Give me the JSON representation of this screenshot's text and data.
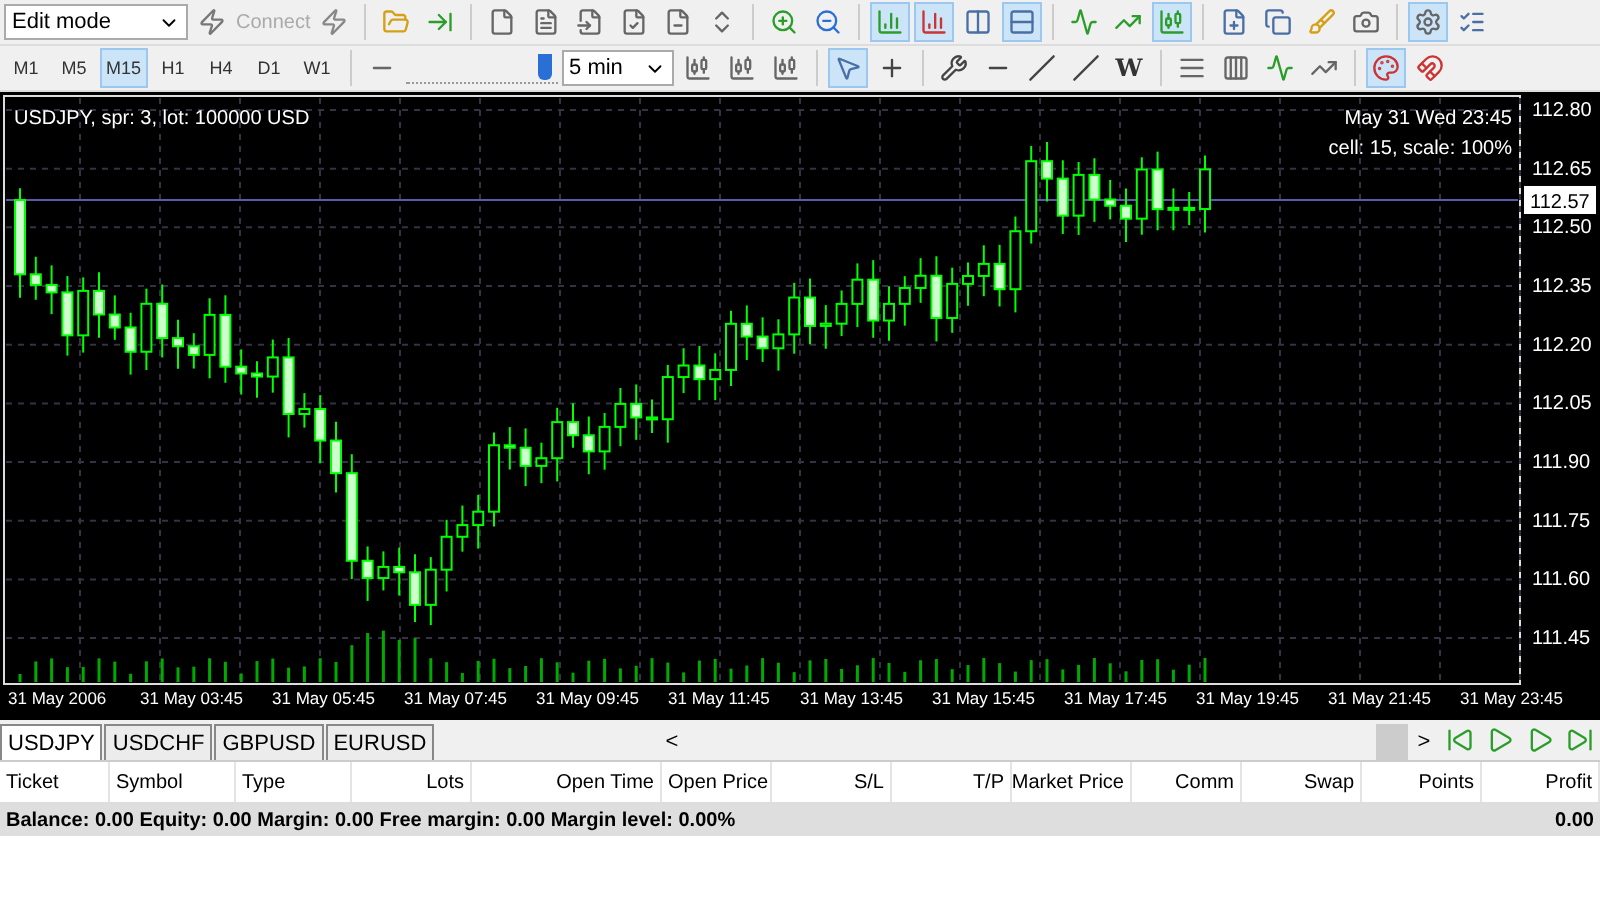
{
  "toolbar": {
    "mode": "Edit mode",
    "connect_label": "Connect",
    "timeframes": [
      {
        "label": "M1",
        "selected": false
      },
      {
        "label": "M5",
        "selected": false
      },
      {
        "label": "M15",
        "selected": true
      },
      {
        "label": "H1",
        "selected": false
      },
      {
        "label": "H4",
        "selected": false
      },
      {
        "label": "D1",
        "selected": false
      },
      {
        "label": "W1",
        "selected": false
      }
    ],
    "speed": {
      "level": 0.93
    },
    "interval": "5 min",
    "text_tool": "W"
  },
  "chart": {
    "title": "USDJPY, spr: 3, lot: 100000 USD",
    "datetime": "May 31 Wed 23:45",
    "scale_info": "cell: 15, scale: 100%",
    "price_labels": [
      "112.80",
      "112.65",
      "112.50",
      "112.35",
      "112.20",
      "112.05",
      "111.90",
      "111.75",
      "111.60",
      "111.45"
    ],
    "current_price": "112.57",
    "time_labels": [
      "31 May 2006",
      "31 May 03:45",
      "31 May 05:45",
      "31 May 07:45",
      "31 May 09:45",
      "31 May 11:45",
      "31 May 13:45",
      "31 May 15:45",
      "31 May 17:45",
      "31 May 19:45",
      "31 May 21:45",
      "31 May 23:45"
    ]
  },
  "symbol_tabs": [
    {
      "label": "USDJPY",
      "selected": true
    },
    {
      "label": "USDCHF",
      "selected": false
    },
    {
      "label": "GBPUSD",
      "selected": false
    },
    {
      "label": "EURUSD",
      "selected": false
    }
  ],
  "scroll_left": "<",
  "scroll_right": ">",
  "table": {
    "columns": [
      "Ticket",
      "Symbol",
      "Type",
      "Lots",
      "Open Time",
      "Open Price",
      "S/L",
      "T/P",
      "Market Price",
      "Comm",
      "Swap",
      "Points",
      "Profit"
    ]
  },
  "status": {
    "summary": "Balance: 0.00 Equity: 0.00 Margin: 0.00 Free margin: 0.00 Margin level: 0.00%",
    "profit": "0.00"
  }
}
